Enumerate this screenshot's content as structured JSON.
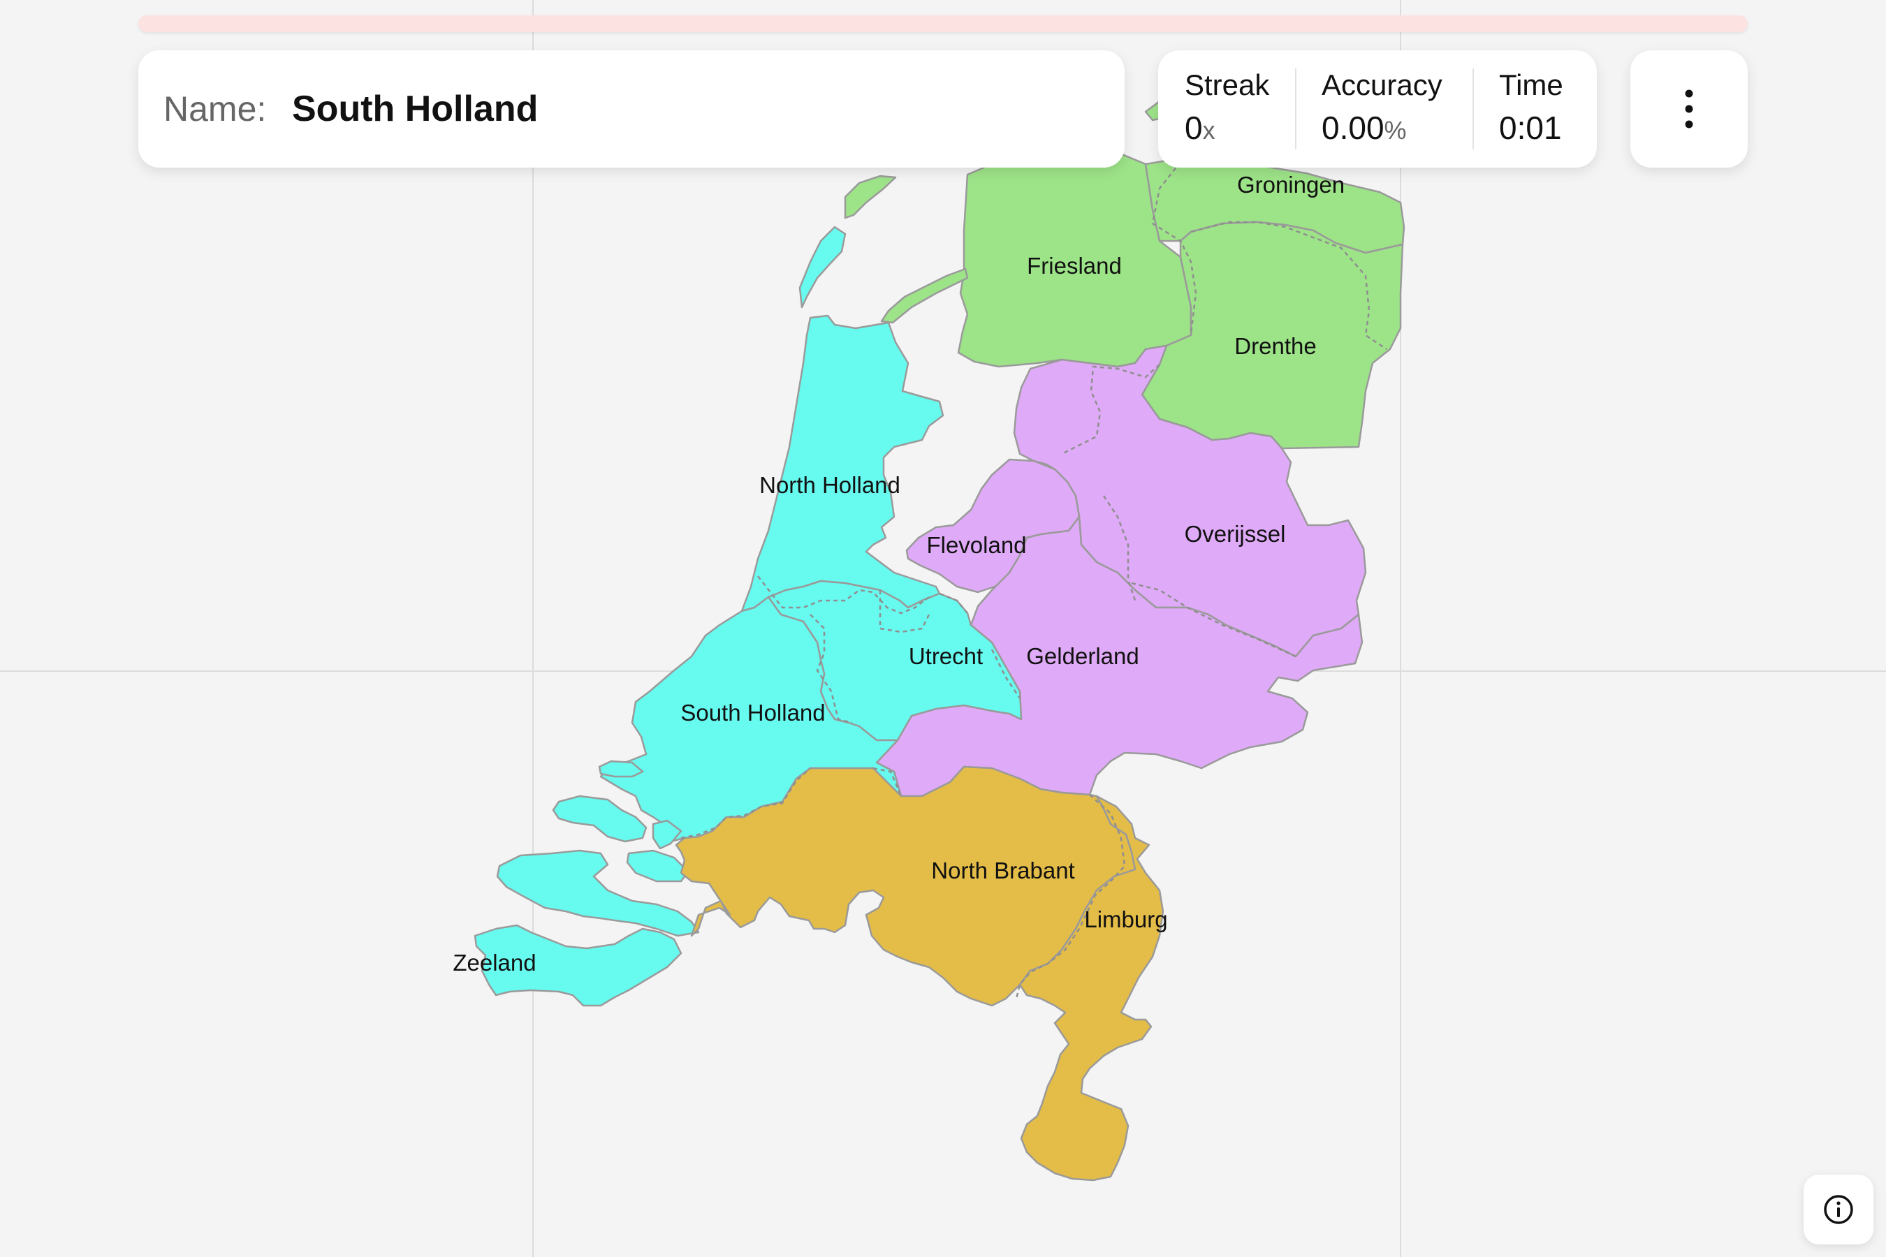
{
  "game": {
    "prompt_label": "Name:",
    "target_region": "South Holland",
    "progress_fraction": 0.0
  },
  "stats": {
    "streak": {
      "label": "Streak",
      "value": "0",
      "unit": "x"
    },
    "accuracy": {
      "label": "Accuracy",
      "value": "0.00",
      "unit": "%"
    },
    "time": {
      "label": "Time",
      "value": "0:01"
    }
  },
  "icons": {
    "menu": "more-vertical-icon",
    "info": "info-icon"
  },
  "colors": {
    "background": "#f4f4f4",
    "progress_track": "#fde2e2",
    "group_north": "#9de388",
    "group_east": "#dfaaf7",
    "group_west": "#67fbf0",
    "group_south": "#e4bc48"
  },
  "map": {
    "country": "Netherlands",
    "regions": [
      {
        "id": "groningen",
        "label": "Groningen",
        "group": "north"
      },
      {
        "id": "friesland",
        "label": "Friesland",
        "group": "north"
      },
      {
        "id": "drenthe",
        "label": "Drenthe",
        "group": "north"
      },
      {
        "id": "north-holland",
        "label": "North Holland",
        "group": "west"
      },
      {
        "id": "flevoland",
        "label": "Flevoland",
        "group": "east"
      },
      {
        "id": "overijssel",
        "label": "Overijssel",
        "group": "east"
      },
      {
        "id": "utrecht",
        "label": "Utrecht",
        "group": "west"
      },
      {
        "id": "gelderland",
        "label": "Gelderland",
        "group": "east"
      },
      {
        "id": "south-holland",
        "label": "South Holland",
        "group": "west"
      },
      {
        "id": "north-brabant",
        "label": "North Brabant",
        "group": "south"
      },
      {
        "id": "limburg",
        "label": "Limburg",
        "group": "south"
      },
      {
        "id": "zeeland",
        "label": "Zeeland",
        "group": "west"
      }
    ]
  }
}
